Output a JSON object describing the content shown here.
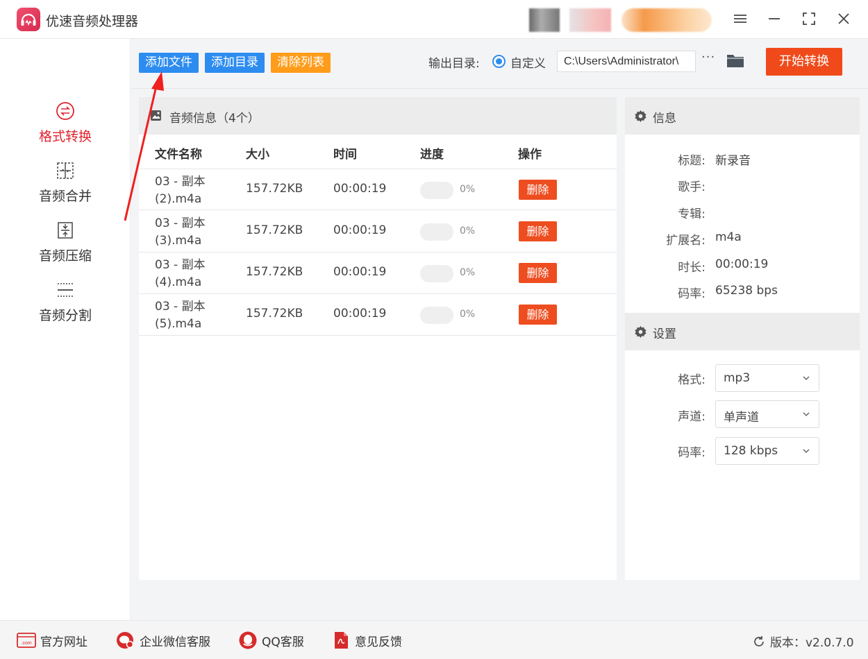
{
  "app": {
    "title": "优速音频处理器"
  },
  "sidebar": {
    "items": [
      {
        "label": "格式转换",
        "icon": "format-convert-icon",
        "active": true
      },
      {
        "label": "音频合并",
        "icon": "audio-merge-icon",
        "active": false
      },
      {
        "label": "音频压缩",
        "icon": "audio-compress-icon",
        "active": false
      },
      {
        "label": "音频分割",
        "icon": "audio-split-icon",
        "active": false
      }
    ]
  },
  "toolbar": {
    "add_file": "添加文件",
    "add_dir": "添加目录",
    "clear_list": "清除列表",
    "output_label": "输出目录:",
    "custom_label": "自定义",
    "output_path": "C:\\Users\\Administrator\\",
    "more": "···",
    "start": "开始转换"
  },
  "file_panel": {
    "title": "音频信息（4个）",
    "columns": [
      "文件名称",
      "大小",
      "时间",
      "进度",
      "操作"
    ],
    "rows": [
      {
        "name": "03 - 副本 (2).m4a",
        "size": "157.72KB",
        "time": "00:00:19",
        "progress": 0,
        "progress_text": "0%",
        "action": "删除"
      },
      {
        "name": "03 - 副本 (3).m4a",
        "size": "157.72KB",
        "time": "00:00:19",
        "progress": 0,
        "progress_text": "0%",
        "action": "删除"
      },
      {
        "name": "03 - 副本 (4).m4a",
        "size": "157.72KB",
        "time": "00:00:19",
        "progress": 0,
        "progress_text": "0%",
        "action": "删除"
      },
      {
        "name": "03 - 副本 (5).m4a",
        "size": "157.72KB",
        "time": "00:00:19",
        "progress": 0,
        "progress_text": "0%",
        "action": "删除"
      }
    ]
  },
  "info": {
    "title": "信息",
    "fields": [
      {
        "label": "标题:",
        "value": "新录音"
      },
      {
        "label": "歌手:",
        "value": ""
      },
      {
        "label": "专辑:",
        "value": ""
      },
      {
        "label": "扩展名:",
        "value": "m4a"
      },
      {
        "label": "时长:",
        "value": "00:00:19"
      },
      {
        "label": "码率:",
        "value": "65238 bps"
      }
    ]
  },
  "settings": {
    "title": "设置",
    "fields": [
      {
        "label": "格式:",
        "value": "mp3"
      },
      {
        "label": "声道:",
        "value": "单声道"
      },
      {
        "label": "码率:",
        "value": "128 kbps"
      }
    ]
  },
  "footer": {
    "links": [
      {
        "label": "官方网址",
        "icon": "website-icon"
      },
      {
        "label": "企业微信客服",
        "icon": "wechat-service-icon"
      },
      {
        "label": "QQ客服",
        "icon": "qq-icon"
      },
      {
        "label": "意见反馈",
        "icon": "feedback-icon"
      }
    ],
    "version": "版本：v2.0.7.0"
  },
  "colors": {
    "accent_blue": "#2d8cf0",
    "accent_orange": "#ff9c1a",
    "accent_red": "#f04a1a",
    "active_red": "#e2222e"
  }
}
